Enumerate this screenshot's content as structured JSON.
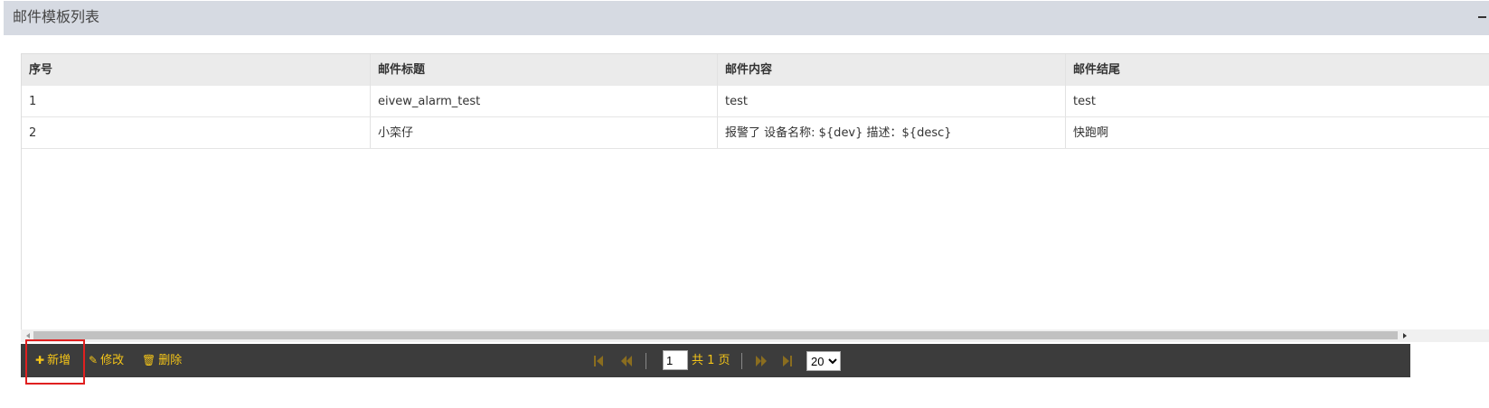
{
  "panel": {
    "title": "邮件模板列表",
    "collapse_icon": "minus-icon"
  },
  "table": {
    "columns": [
      "序号",
      "邮件标题",
      "邮件内容",
      "邮件结尾"
    ],
    "rows": [
      [
        "1",
        "eivew_alarm_test",
        "test",
        "test"
      ],
      [
        "2",
        "小栾仔",
        "报警了 设备名称: ${dev}   描述：${desc}",
        "快跑啊"
      ]
    ]
  },
  "toolbar": {
    "add_label": "新增",
    "add_icon": "plus-icon",
    "edit_label": "修改",
    "edit_icon": "pencil-icon",
    "delete_label": "删除",
    "delete_icon": "trash-icon"
  },
  "pager": {
    "current_page": "1",
    "total_text": "共 1 页",
    "page_size": "20",
    "page_size_options": [
      "20"
    ]
  },
  "colors": {
    "header_bg": "#d6dae2",
    "toolbar_bg": "#3c3c3c",
    "toolbar_text": "#f5c518",
    "highlight": "#e02020"
  }
}
